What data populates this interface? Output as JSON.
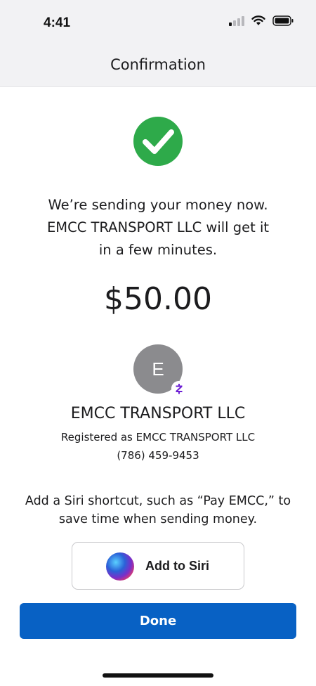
{
  "status_bar": {
    "time": "4:41",
    "icons": [
      "cellular-signal-icon",
      "wifi-icon",
      "battery-icon"
    ]
  },
  "header": {
    "title": "Confirmation"
  },
  "confirmation": {
    "icon": "checkmark-icon",
    "message_lines": [
      "We’re sending your money now.",
      "EMCC TRANSPORT LLC will get it",
      "in a few minutes."
    ],
    "amount": "$50.00"
  },
  "recipient": {
    "avatar_initial": "E",
    "badge_icon": "zelle-icon",
    "name": "EMCC TRANSPORT LLC",
    "registered": "Registered as EMCC TRANSPORT LLC",
    "phone": "(786) 459-9453"
  },
  "siri": {
    "prompt_lines": [
      "Add a Siri shortcut, such as “Pay EMCC,” to",
      "save time when sending money."
    ],
    "button_label": "Add to Siri",
    "button_icon": "siri-icon"
  },
  "actions": {
    "done_label": "Done"
  },
  "colors": {
    "success_green": "#2eaa4a",
    "primary_blue": "#0861c4",
    "zelle_purple": "#6d1ed4",
    "avatar_gray": "#8b8b8e"
  }
}
